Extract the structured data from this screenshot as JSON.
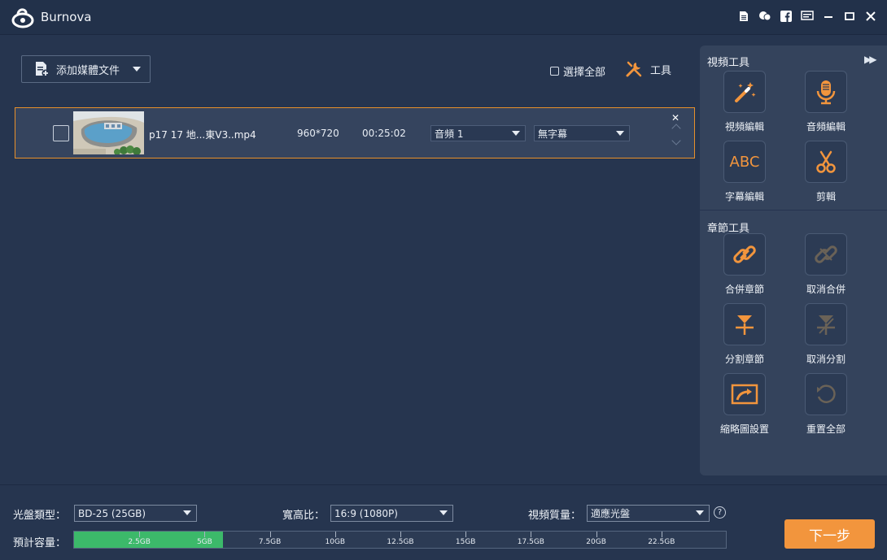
{
  "app": {
    "title": "Burnova"
  },
  "window_icons": [
    "file-icon",
    "feedback-icon",
    "facebook-icon",
    "menu-icon",
    "minimize-icon",
    "maximize-icon",
    "close-icon"
  ],
  "toolbar": {
    "add_media_label": "添加媒體文件",
    "select_all_label": "選擇全部",
    "tools_label": "工具"
  },
  "media_item": {
    "filename": "p17 17 地...東V3..mp4",
    "resolution": "960*720",
    "duration": "00:25:02",
    "audio_track": "音頻 1",
    "subtitle": "無字幕"
  },
  "video_tools": {
    "title": "視頻工具",
    "items": [
      {
        "label": "視頻編輯",
        "icon": "magic-wand-icon"
      },
      {
        "label": "音頻編輯",
        "icon": "microphone-icon"
      },
      {
        "label": "字幕編輯",
        "icon": "abc-text-icon",
        "glyph": "ABC"
      },
      {
        "label": "剪輯",
        "icon": "scissors-icon"
      }
    ]
  },
  "chapter_tools": {
    "title": "章節工具",
    "items": [
      {
        "label": "合併章節",
        "icon": "link-icon"
      },
      {
        "label": "取消合併",
        "icon": "unlink-icon"
      },
      {
        "label": "分割章節",
        "icon": "split-icon"
      },
      {
        "label": "取消分割",
        "icon": "unsplit-icon"
      },
      {
        "label": "縮略圖設置",
        "icon": "thumbnail-icon"
      },
      {
        "label": "重置全部",
        "icon": "reset-icon"
      }
    ]
  },
  "bottom": {
    "disc_type_label": "光盤類型：",
    "disc_type_value": "BD-25 (25GB)",
    "aspect_label": "寬高比：",
    "aspect_value": "16:9 (1080P)",
    "quality_label": "視頻質量：",
    "quality_value": "適應光盤",
    "help_glyph": "?",
    "capacity_label": "預計容量：",
    "capacity_fill_fraction": 0.228,
    "capacity_ticks": [
      "2.5GB",
      "5GB",
      "7.5GB",
      "10GB",
      "12.5GB",
      "15GB",
      "17.5GB",
      "20GB",
      "22.5GB"
    ],
    "next_label": "下一步"
  },
  "colors": {
    "accent": "#f2953d",
    "selection_border": "#e8902a",
    "capacity_fill": "#3cb96a",
    "background": "#26354f"
  }
}
